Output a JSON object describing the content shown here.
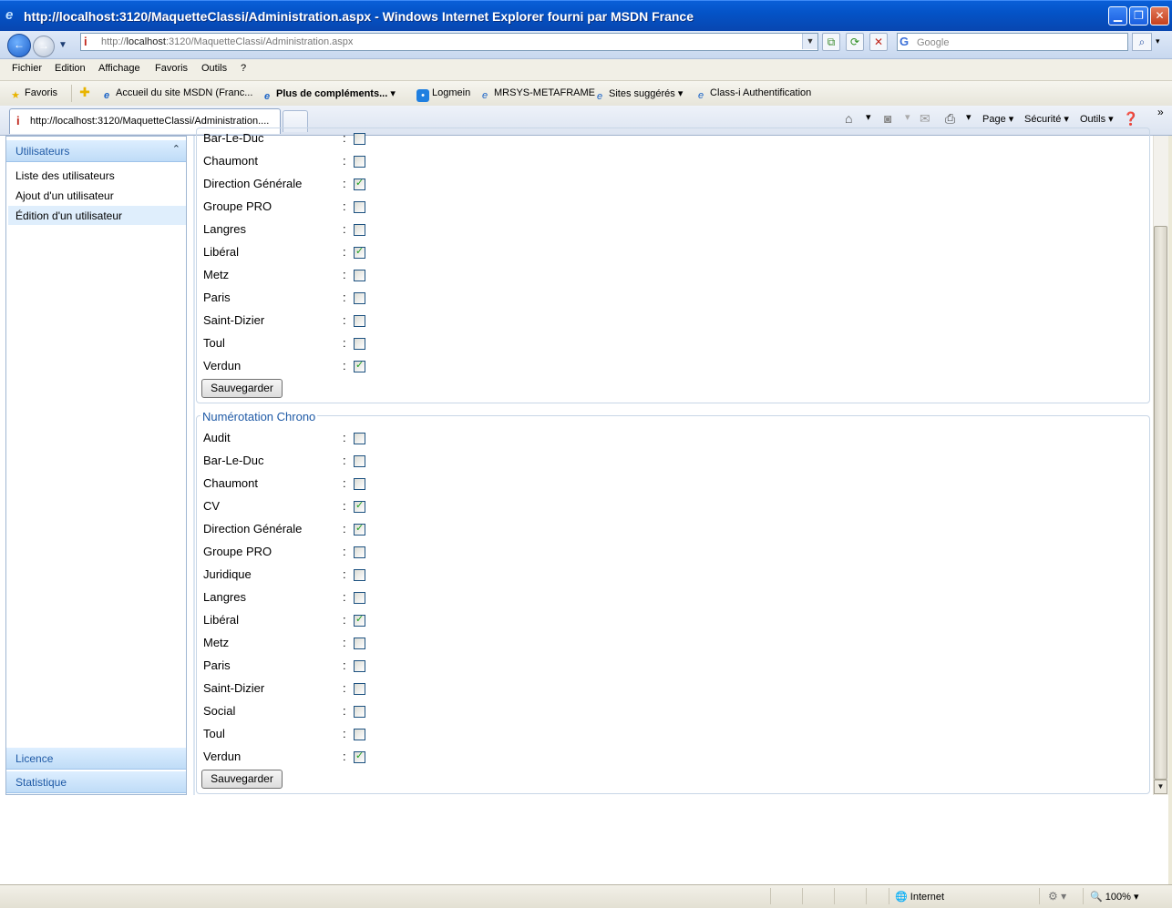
{
  "window": {
    "title": "http://localhost:3120/MaquetteClassi/Administration.aspx - Windows Internet Explorer fourni par MSDN France"
  },
  "address": {
    "url_prefix": "http://",
    "url_host": "localhost",
    "url_rest": ":3120/MaquetteClassi/Administration.aspx",
    "search_placeholder": "Google"
  },
  "menu": [
    "Fichier",
    "Edition",
    "Affichage",
    "Favoris",
    "Outils",
    "?"
  ],
  "favorites": {
    "label": "Favoris",
    "items": [
      "Accueil du site MSDN (Franc...",
      "Plus de compléments...",
      "Logmein",
      "MRSYS-METAFRAME",
      "Sites suggérés",
      "Class-i Authentification"
    ]
  },
  "tab": {
    "title": "http://localhost:3120/MaquetteClassi/Administration...."
  },
  "commands": {
    "page": "Page",
    "security": "Sécurité",
    "tools": "Outils"
  },
  "sidebar": {
    "section_users": "Utilisateurs",
    "links": [
      "Liste des utilisateurs",
      "Ajout d'un utilisateur",
      "Édition d'un utilisateur"
    ],
    "section_licence": "Licence",
    "section_stats": "Statistique"
  },
  "group1": {
    "rows": [
      {
        "label": "Bar-Le-Duc",
        "checked": false
      },
      {
        "label": "Chaumont",
        "checked": false
      },
      {
        "label": "Direction Générale",
        "checked": true
      },
      {
        "label": "Groupe PRO",
        "checked": false
      },
      {
        "label": "Langres",
        "checked": false
      },
      {
        "label": "Libéral",
        "checked": true
      },
      {
        "label": "Metz",
        "checked": false
      },
      {
        "label": "Paris",
        "checked": false
      },
      {
        "label": "Saint-Dizier",
        "checked": false
      },
      {
        "label": "Toul",
        "checked": false
      },
      {
        "label": "Verdun",
        "checked": true
      }
    ],
    "save_label": "Sauvegarder"
  },
  "group2": {
    "legend": "Numérotation Chrono",
    "rows": [
      {
        "label": "Audit",
        "checked": false
      },
      {
        "label": "Bar-Le-Duc",
        "checked": false
      },
      {
        "label": "Chaumont",
        "checked": false
      },
      {
        "label": "CV",
        "checked": true
      },
      {
        "label": "Direction Générale",
        "checked": true
      },
      {
        "label": "Groupe PRO",
        "checked": false
      },
      {
        "label": "Juridique",
        "checked": false
      },
      {
        "label": "Langres",
        "checked": false
      },
      {
        "label": "Libéral",
        "checked": true
      },
      {
        "label": "Metz",
        "checked": false
      },
      {
        "label": "Paris",
        "checked": false
      },
      {
        "label": "Saint-Dizier",
        "checked": false
      },
      {
        "label": "Social",
        "checked": false
      },
      {
        "label": "Toul",
        "checked": false
      },
      {
        "label": "Verdun",
        "checked": true
      }
    ],
    "save_label": "Sauvegarder"
  },
  "colon": ":",
  "status": {
    "zone": "Internet",
    "zoom": "100%"
  }
}
